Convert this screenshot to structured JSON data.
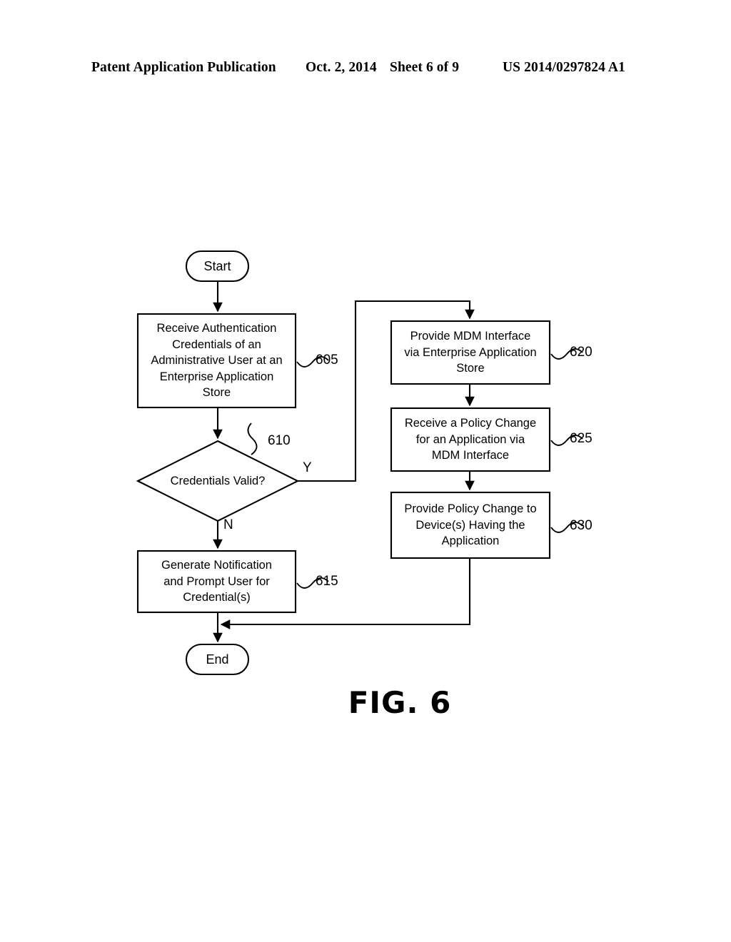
{
  "header": {
    "publication": "Patent Application Publication",
    "date": "Oct. 2, 2014",
    "sheet": "Sheet 6 of 9",
    "patent_number": "US 2014/0297824 A1"
  },
  "figure": {
    "caption": "FIG. 6",
    "line_color": "#000000",
    "fill_color": "#ffffff"
  },
  "nodes": {
    "start": {
      "label": "Start",
      "ref": ""
    },
    "step605": {
      "label": "Receive Authentication\nCredentials of an\nAdministrative User at an\nEnterprise Application\nStore",
      "ref": "605"
    },
    "decision610": {
      "label": "Credentials Valid?",
      "ref": "610",
      "yes_label": "Y",
      "no_label": "N"
    },
    "step615": {
      "label": "Generate Notification\nand Prompt User for\nCredential(s)",
      "ref": "615"
    },
    "step620": {
      "label": "Provide MDM Interface\nvia Enterprise Application\nStore",
      "ref": "620"
    },
    "step625": {
      "label": "Receive a Policy Change\nfor an Application via\nMDM Interface",
      "ref": "625"
    },
    "step630": {
      "label": "Provide Policy Change to\nDevice(s) Having the\nApplication",
      "ref": "630"
    },
    "end": {
      "label": "End",
      "ref": ""
    }
  }
}
